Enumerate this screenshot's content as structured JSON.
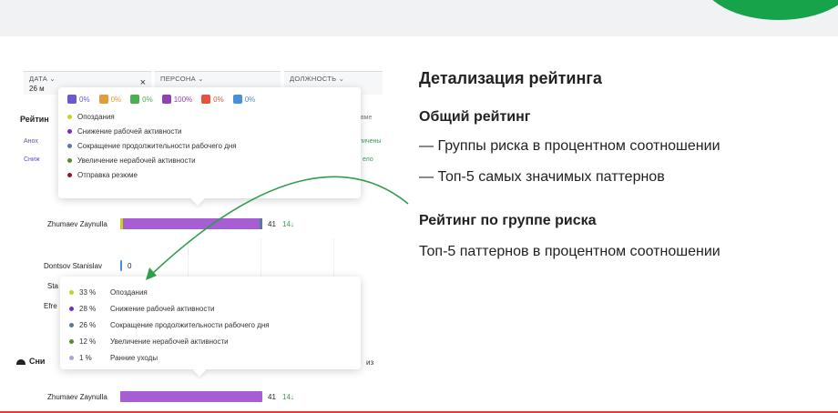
{
  "slide": {
    "title": "Детализация рейтинга",
    "sections": [
      {
        "heading": "Общий рейтинг",
        "lines": [
          "— Группы риска в процентном соотношении",
          "— Топ-5 самых значимых паттернов"
        ]
      },
      {
        "heading": "Рейтинг по группе риска",
        "lines": [
          "Топ-5 паттернов в процентном соотношении"
        ]
      }
    ]
  },
  "filters": [
    {
      "label": "ДАТА",
      "value": "26 м",
      "clear": "×"
    },
    {
      "label": "ПЕРСОНА",
      "value": ""
    },
    {
      "label": "ДОЛЖНОСТЬ",
      "value": ""
    }
  ],
  "side_labels": {
    "rating": "Рейтин",
    "row1": "Анох",
    "row2": "Сниж",
    "right1": "вме",
    "right2": "личены",
    "right3": "ело",
    "section2": "Сни",
    "section2_right": "из"
  },
  "top_popup": {
    "icons": [
      {
        "icon": "usb-icon",
        "value": "0%",
        "color": "#6a5acd"
      },
      {
        "icon": "document-icon",
        "value": "0%",
        "color": "#e49b3a"
      },
      {
        "icon": "megaphone-icon",
        "value": "0%",
        "color": "#4caf50"
      },
      {
        "icon": "speedometer-icon",
        "value": "100%",
        "color": "#8e44ad"
      },
      {
        "icon": "network-icon",
        "value": "0%",
        "color": "#e5533c"
      },
      {
        "icon": "people-icon",
        "value": "0%",
        "color": "#4a90d9"
      }
    ],
    "legend": [
      {
        "label": "Опоздания",
        "color": "#c4d321"
      },
      {
        "label": "Снижение рабочей активности",
        "color": "#7a2dbd"
      },
      {
        "label": "Сокращение продолжительности рабочего дня",
        "color": "#5a7a9a"
      },
      {
        "label": "Увеличение нерабочей активности",
        "color": "#5c8a2a"
      },
      {
        "label": "Отправка резюме",
        "color": "#8b1a2e"
      }
    ]
  },
  "rows": [
    {
      "name": "Zhumaev Zaynulla",
      "value": "41",
      "trend": "14↓",
      "fill": 0.72
    },
    {
      "name": "Dontsov Stanislav",
      "value": "0",
      "fill": 0
    },
    {
      "name": "Sta",
      "value": "",
      "fill": 0
    },
    {
      "name": "Efre",
      "value": "",
      "fill": 0
    }
  ],
  "bottom_popup": {
    "legend": [
      {
        "pct": "33 %",
        "label": "Опоздания",
        "color": "#c4d321"
      },
      {
        "pct": "28 %",
        "label": "Снижение рабочей активности",
        "color": "#7a2dbd"
      },
      {
        "pct": "26 %",
        "label": "Сокращение продолжительности рабочего дня",
        "color": "#5a7a9a"
      },
      {
        "pct": "12 %",
        "label": "Увеличение нерабочей активности",
        "color": "#5c8a2a"
      },
      {
        "pct": "1 %",
        "label": "Ранние уходы",
        "color": "#b69ee6"
      }
    ]
  },
  "bottom_row": {
    "name": "Zhumaev Zaynulla",
    "value": "41",
    "trend": "14↓",
    "fill": 0.72
  },
  "colors": {
    "accent_green": "#16a34a",
    "bar_purple": "#a65ed2",
    "arrow_green": "#2e9e4a"
  }
}
